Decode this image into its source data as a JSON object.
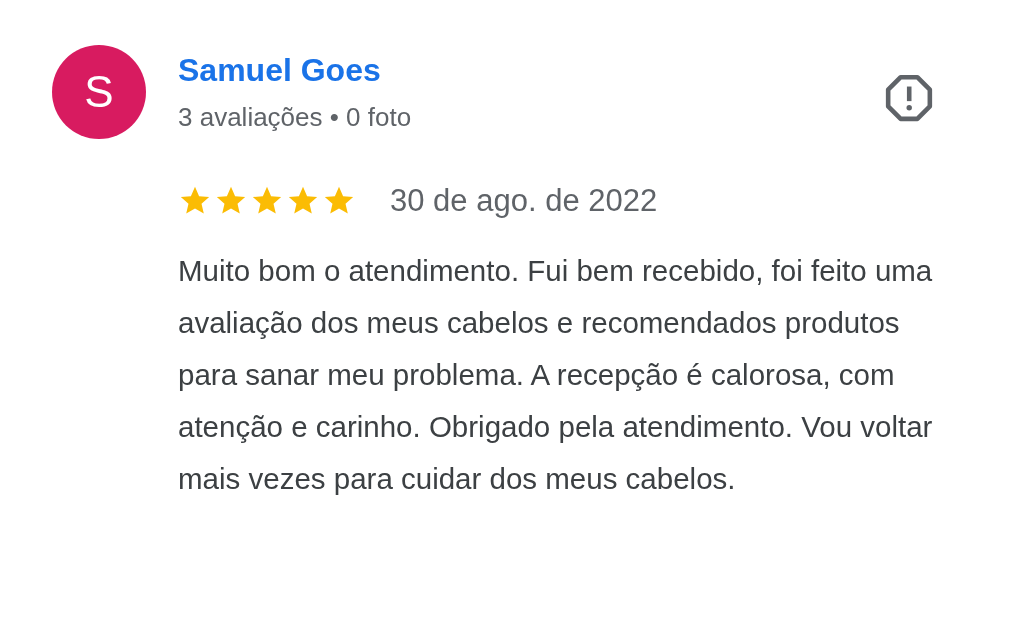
{
  "review": {
    "avatar_letter": "S",
    "author": "Samuel Goes",
    "meta": "3 avaliações • 0 foto",
    "stars": 5,
    "date": "30 de ago. de 2022",
    "text": "Muito bom o atendimento. Fui bem recebido, foi feito uma avaliação dos meus cabelos e recomendados produtos para sanar meu problema. A recepção é calorosa, com atenção e carinho. Obrigado pela atendimento. Vou voltar mais vezes para cuidar dos meus cabelos."
  }
}
